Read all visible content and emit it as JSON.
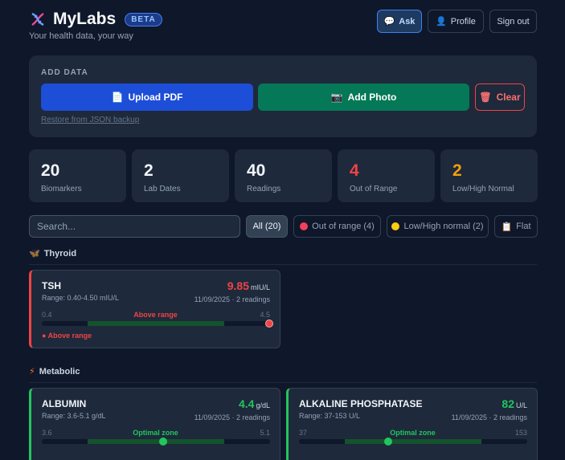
{
  "header": {
    "app_title": "MyLabs",
    "badge": "BETA",
    "tagline": "Your health data, your way",
    "actions": {
      "ask": "Ask",
      "profile": "Profile",
      "sign_out": "Sign out"
    }
  },
  "add_data": {
    "label": "ADD DATA",
    "upload_pdf": "Upload PDF",
    "add_photo": "Add Photo",
    "clear": "Clear",
    "restore_link": "Restore from JSON backup"
  },
  "stats": [
    {
      "value": "20",
      "label": "Biomarkers"
    },
    {
      "value": "2",
      "label": "Lab Dates"
    },
    {
      "value": "40",
      "label": "Readings"
    },
    {
      "value": "4",
      "label": "Out of Range"
    },
    {
      "value": "2",
      "label": "Low/High Normal"
    }
  ],
  "filters": {
    "search_placeholder": "Search...",
    "all": "All (20)",
    "out_of_range": "Out of range (4)",
    "low_high_normal": "Low/High normal (2)",
    "flat": "Flat"
  },
  "sections": [
    {
      "title": "Thyroid",
      "cards": [
        {
          "name": "TSH",
          "range": "Range: 0.40-4.50 mIU/L",
          "value": "9.85",
          "unit": "mIU/L",
          "date": "11/09/2025 · 2 readings",
          "min": "0.4",
          "max": "4.5",
          "zone": "Above range",
          "flag": "● Above range",
          "position": 1.0
        }
      ]
    },
    {
      "title": "Metabolic",
      "cards": [
        {
          "name": "ALBUMIN",
          "range": "Range: 3.6-5.1 g/dL",
          "value": "4.4",
          "unit": "g/dL",
          "date": "11/09/2025 · 2 readings",
          "min": "3.6",
          "max": "5.1",
          "zone": "Optimal zone",
          "position": 0.53
        },
        {
          "name": "ALKALINE PHOSPHATASE",
          "range": "Range: 37-153 U/L",
          "value": "82",
          "unit": "U/L",
          "date": "11/09/2025 · 2 readings",
          "min": "37",
          "max": "153",
          "zone": "Optimal zone",
          "position": 0.39
        }
      ]
    }
  ],
  "colors": {
    "bad": "#ef4444",
    "good": "#22c55e",
    "amber": "#f59e0b",
    "accent": "#1d4ed8"
  }
}
